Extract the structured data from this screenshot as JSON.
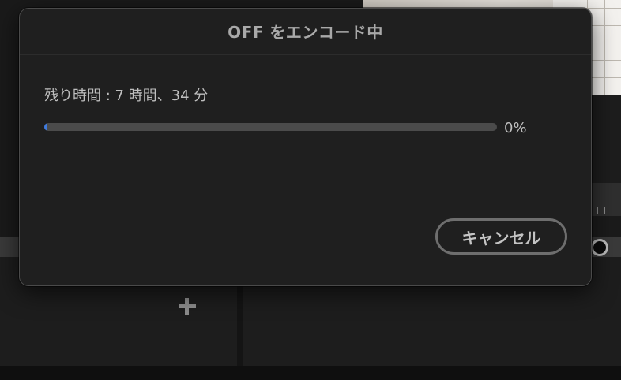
{
  "dialog": {
    "title": "OFF をエンコード中",
    "remaining_label": "残り時間 : 7 時間、34 分",
    "progress": {
      "value": 0,
      "percent_text": "0%"
    },
    "cancel_label": "キャンセル"
  },
  "colors": {
    "progress_fill": "#3f7be0",
    "progress_track": "#4b4b4b",
    "dialog_background": "#1f1f1f"
  },
  "icons": {
    "add": "plus-icon",
    "playhead": "playhead-circle-icon"
  }
}
